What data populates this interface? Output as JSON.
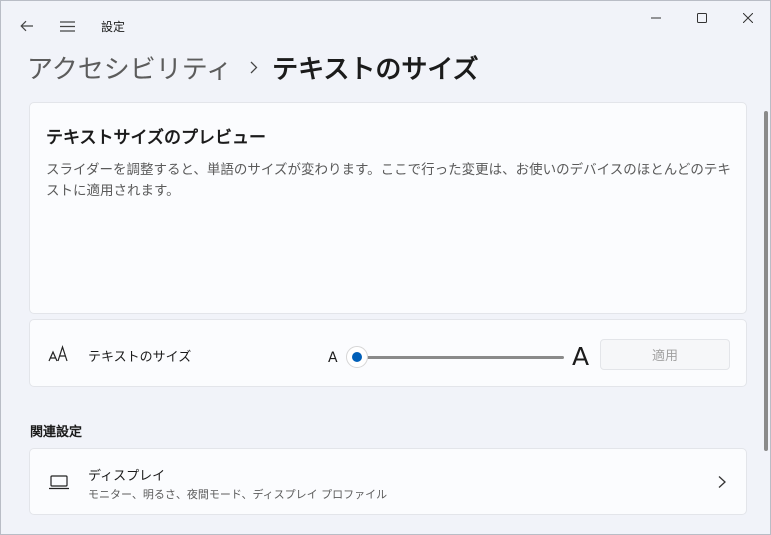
{
  "window": {
    "app_title": "設定",
    "icons": {
      "back": "back-arrow-icon",
      "menu": "hamburger-menu-icon",
      "minimize": "minimize-icon",
      "maximize": "maximize-icon",
      "close": "close-icon"
    }
  },
  "breadcrumb": {
    "parent": "アクセシビリティ",
    "separator_icon": "chevron-right-icon",
    "current": "テキストのサイズ"
  },
  "preview": {
    "title": "テキストサイズのプレビュー",
    "text": "スライダーを調整すると、単語のサイズが変わります。ここで行った変更は、お使いのデバイスのほとんどのテキストに適用されます。"
  },
  "text_size": {
    "icon": "text-size-icon",
    "label": "テキストのサイズ",
    "small_glyph": "A",
    "large_glyph": "A",
    "slider_value_fraction": 0.0,
    "apply_label": "適用",
    "apply_enabled": false
  },
  "related": {
    "heading": "関連設定",
    "items": [
      {
        "icon": "laptop-display-icon",
        "title": "ディスプレイ",
        "subtitle": "モニター、明るさ、夜間モード、ディスプレイ プロファイル",
        "chevron_icon": "chevron-right-icon"
      }
    ]
  },
  "colors": {
    "accent": "#005fb8",
    "window_bg": "#f1f3f9",
    "card_bg": "#fbfcfe"
  }
}
